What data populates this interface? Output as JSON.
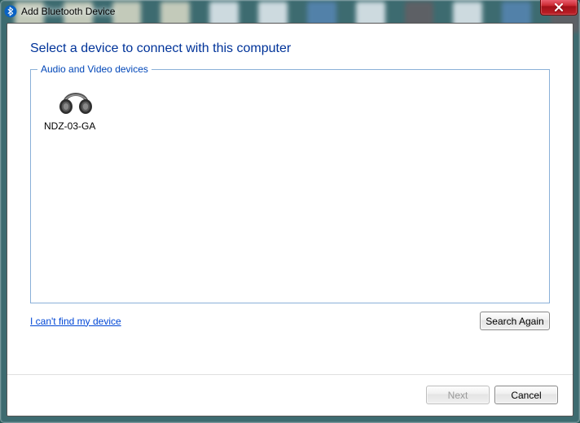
{
  "window": {
    "title": "Add Bluetooth Device"
  },
  "wizard": {
    "heading": "Select a device to connect with this computer",
    "groupLabel": "Audio and Video devices",
    "devices": [
      {
        "name": "NDZ-03-GA"
      }
    ],
    "helpLink": "I can't find my device",
    "searchAgain": "Search Again",
    "nextLabel": "Next",
    "cancelLabel": "Cancel"
  }
}
